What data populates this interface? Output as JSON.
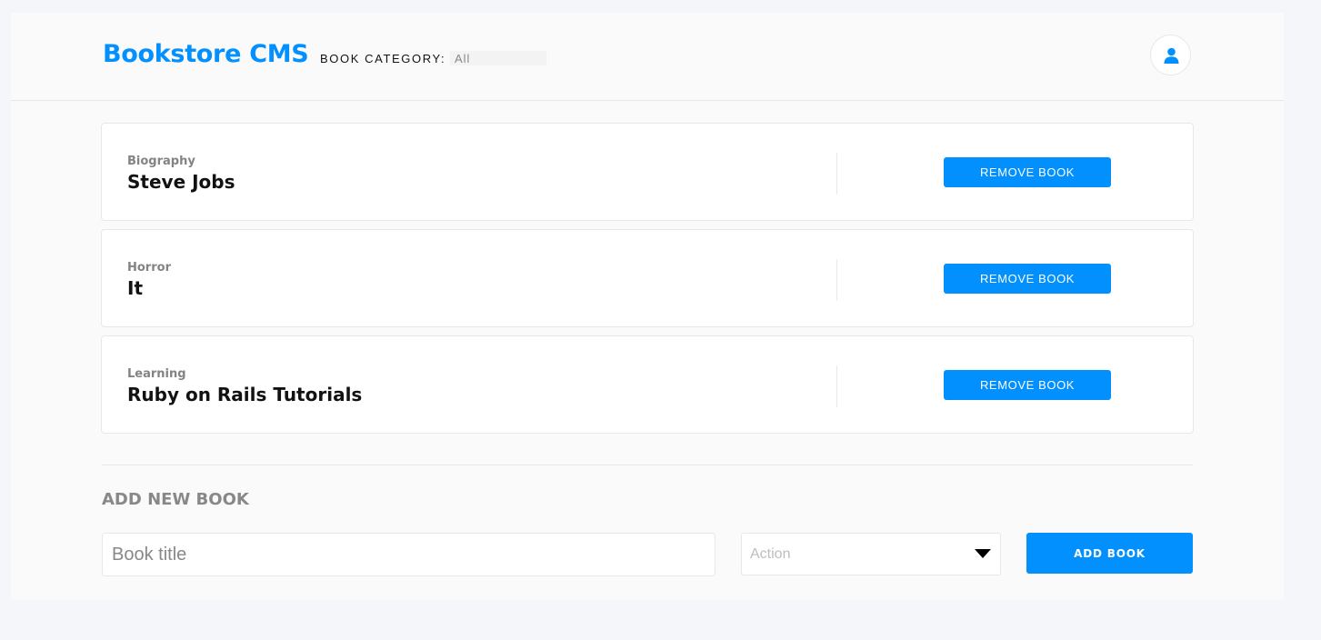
{
  "header": {
    "brand": "Bookstore CMS",
    "category_label": "BOOK CATEGORY:",
    "category_value": "All",
    "user_icon": "user-icon"
  },
  "books": [
    {
      "category": "Biography",
      "title": "Steve Jobs",
      "remove_label": "REMOVE BOOK"
    },
    {
      "category": "Horror",
      "title": "It",
      "remove_label": "REMOVE BOOK"
    },
    {
      "category": "Learning",
      "title": "Ruby on Rails Tutorials",
      "remove_label": "REMOVE BOOK"
    }
  ],
  "form": {
    "heading": "ADD NEW BOOK",
    "title_placeholder": "Book title",
    "title_value": "",
    "category_placeholder": "Action",
    "submit_label": "ADD BOOK"
  },
  "colors": {
    "accent": "#0290ff",
    "page_background": "#f5f6fa",
    "panel_background": "#fafafa"
  }
}
